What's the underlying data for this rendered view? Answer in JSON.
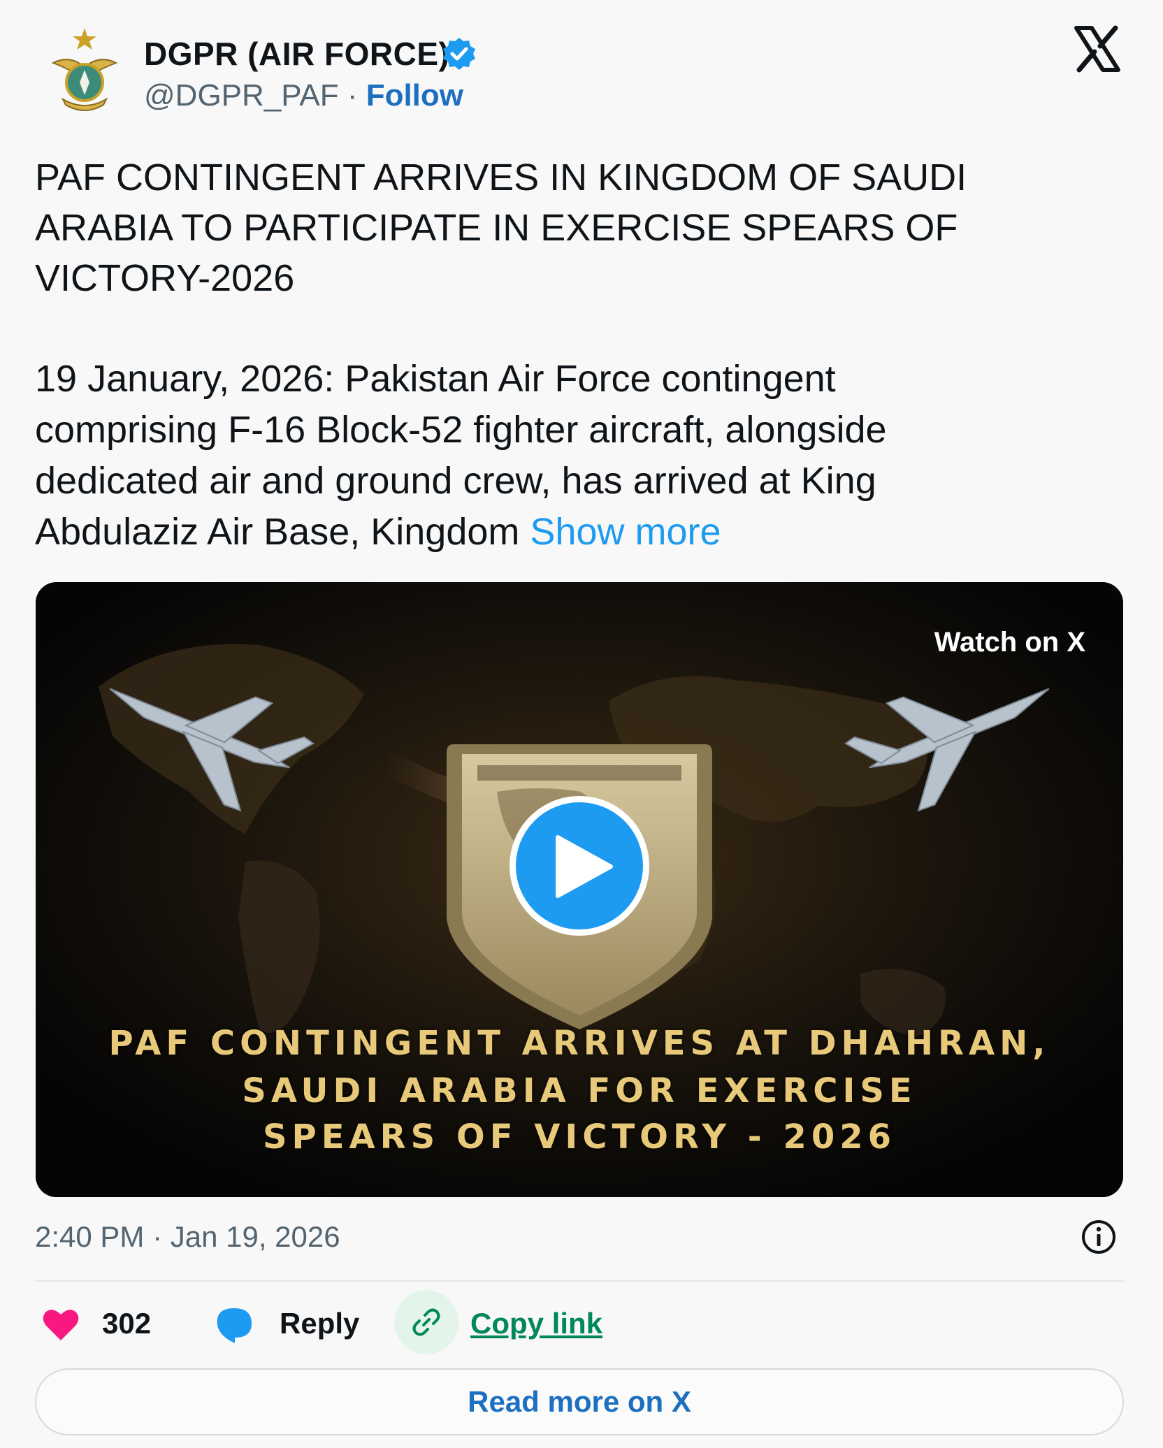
{
  "author": {
    "name": "DGPR (AIR FORCE)",
    "handle": "@DGPR_PAF",
    "separator": "·",
    "follow_label": "Follow",
    "avatar_icon": "paf-emblem-icon",
    "verified_icon": "verified-badge-icon"
  },
  "brand_icon": "x-logo-icon",
  "post": {
    "headline": "PAF CONTINGENT ARRIVES IN KINGDOM OF SAUDI ARABIA TO PARTICIPATE IN EXERCISE SPEARS OF VICTORY-2026",
    "body": "19 January, 2026: Pakistan Air Force contingent comprising F-16 Block-52 fighter aircraft, alongside dedicated air and ground crew, has arrived at King Abdulaziz Air Base, Kingdom ",
    "show_more_label": "Show more"
  },
  "video": {
    "watch_label": "Watch on X",
    "caption_lines": [
      "PAF CONTINGENT ARRIVES AT DHAHRAN,",
      "SAUDI ARABIA FOR EXERCISE",
      "SPEARS OF VICTORY - 2026"
    ],
    "play_icon": "play-icon"
  },
  "meta": {
    "timestamp": "2:40 PM · Jan 19, 2026",
    "info_icon": "info-icon"
  },
  "actions": {
    "like_count": "302",
    "reply_label": "Reply",
    "copy_link_label": "Copy link"
  },
  "read_more_label": "Read more on X",
  "colors": {
    "accent_blue": "#1d9bf0",
    "link_blue": "#1d6fbf",
    "heart_pink": "#f91880",
    "copy_green": "#00875a",
    "caption_gold": "#e8c97a"
  }
}
